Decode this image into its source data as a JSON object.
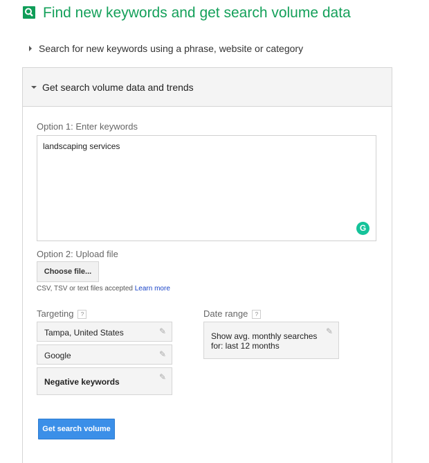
{
  "header": {
    "title": "Find new keywords and get search volume data",
    "icon": "search-icon",
    "accent": "#14a05a"
  },
  "sections": {
    "collapsed_label": "Search for new keywords using a phrase, website or category",
    "expanded_label": "Get search volume data and trends"
  },
  "form": {
    "option1_label": "Option 1: Enter keywords",
    "keywords_value": "landscaping services",
    "option2_label": "Option 2: Upload file",
    "choose_file": "Choose file...",
    "file_hint": "CSV, TSV or text files accepted",
    "learn_more": "Learn more",
    "targeting_label": "Targeting",
    "targeting": [
      "Tampa, United States",
      "Google",
      "Negative keywords"
    ],
    "date_range_label": "Date range",
    "date_range_line1": "Show avg. monthly searches",
    "date_range_line2": "for: last 12 months",
    "help": "?",
    "submit": "Get search volume",
    "submit_color": "#3b8fe8"
  }
}
